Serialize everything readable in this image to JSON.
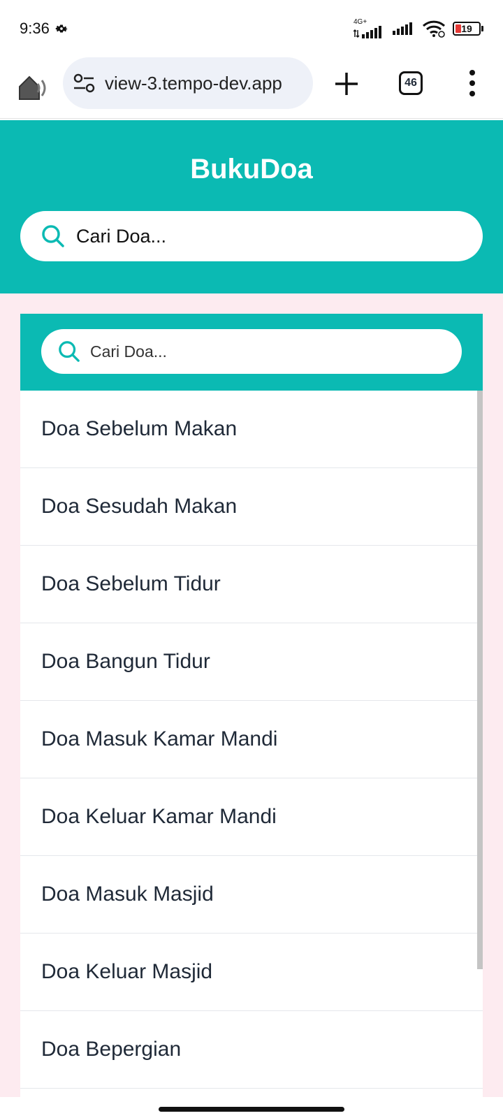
{
  "status_bar": {
    "time": "9:36",
    "network": "4G+",
    "battery": "19"
  },
  "browser": {
    "url": "view-3.tempo-dev.app",
    "tab_count": "46"
  },
  "app": {
    "title": "BukuDoa",
    "search_placeholder": "Cari Doa..."
  },
  "panel": {
    "search_placeholder": "Cari Doa...",
    "items": [
      "Doa Sebelum Makan",
      "Doa Sesudah Makan",
      "Doa Sebelum Tidur",
      "Doa Bangun Tidur",
      "Doa Masuk Kamar Mandi",
      "Doa Keluar Kamar Mandi",
      "Doa Masuk Masjid",
      "Doa Keluar Masjid",
      "Doa Bepergian",
      ""
    ]
  },
  "colors": {
    "accent": "#0bbab3",
    "page_background": "#fdebf0",
    "battery_low": "#e53935"
  }
}
